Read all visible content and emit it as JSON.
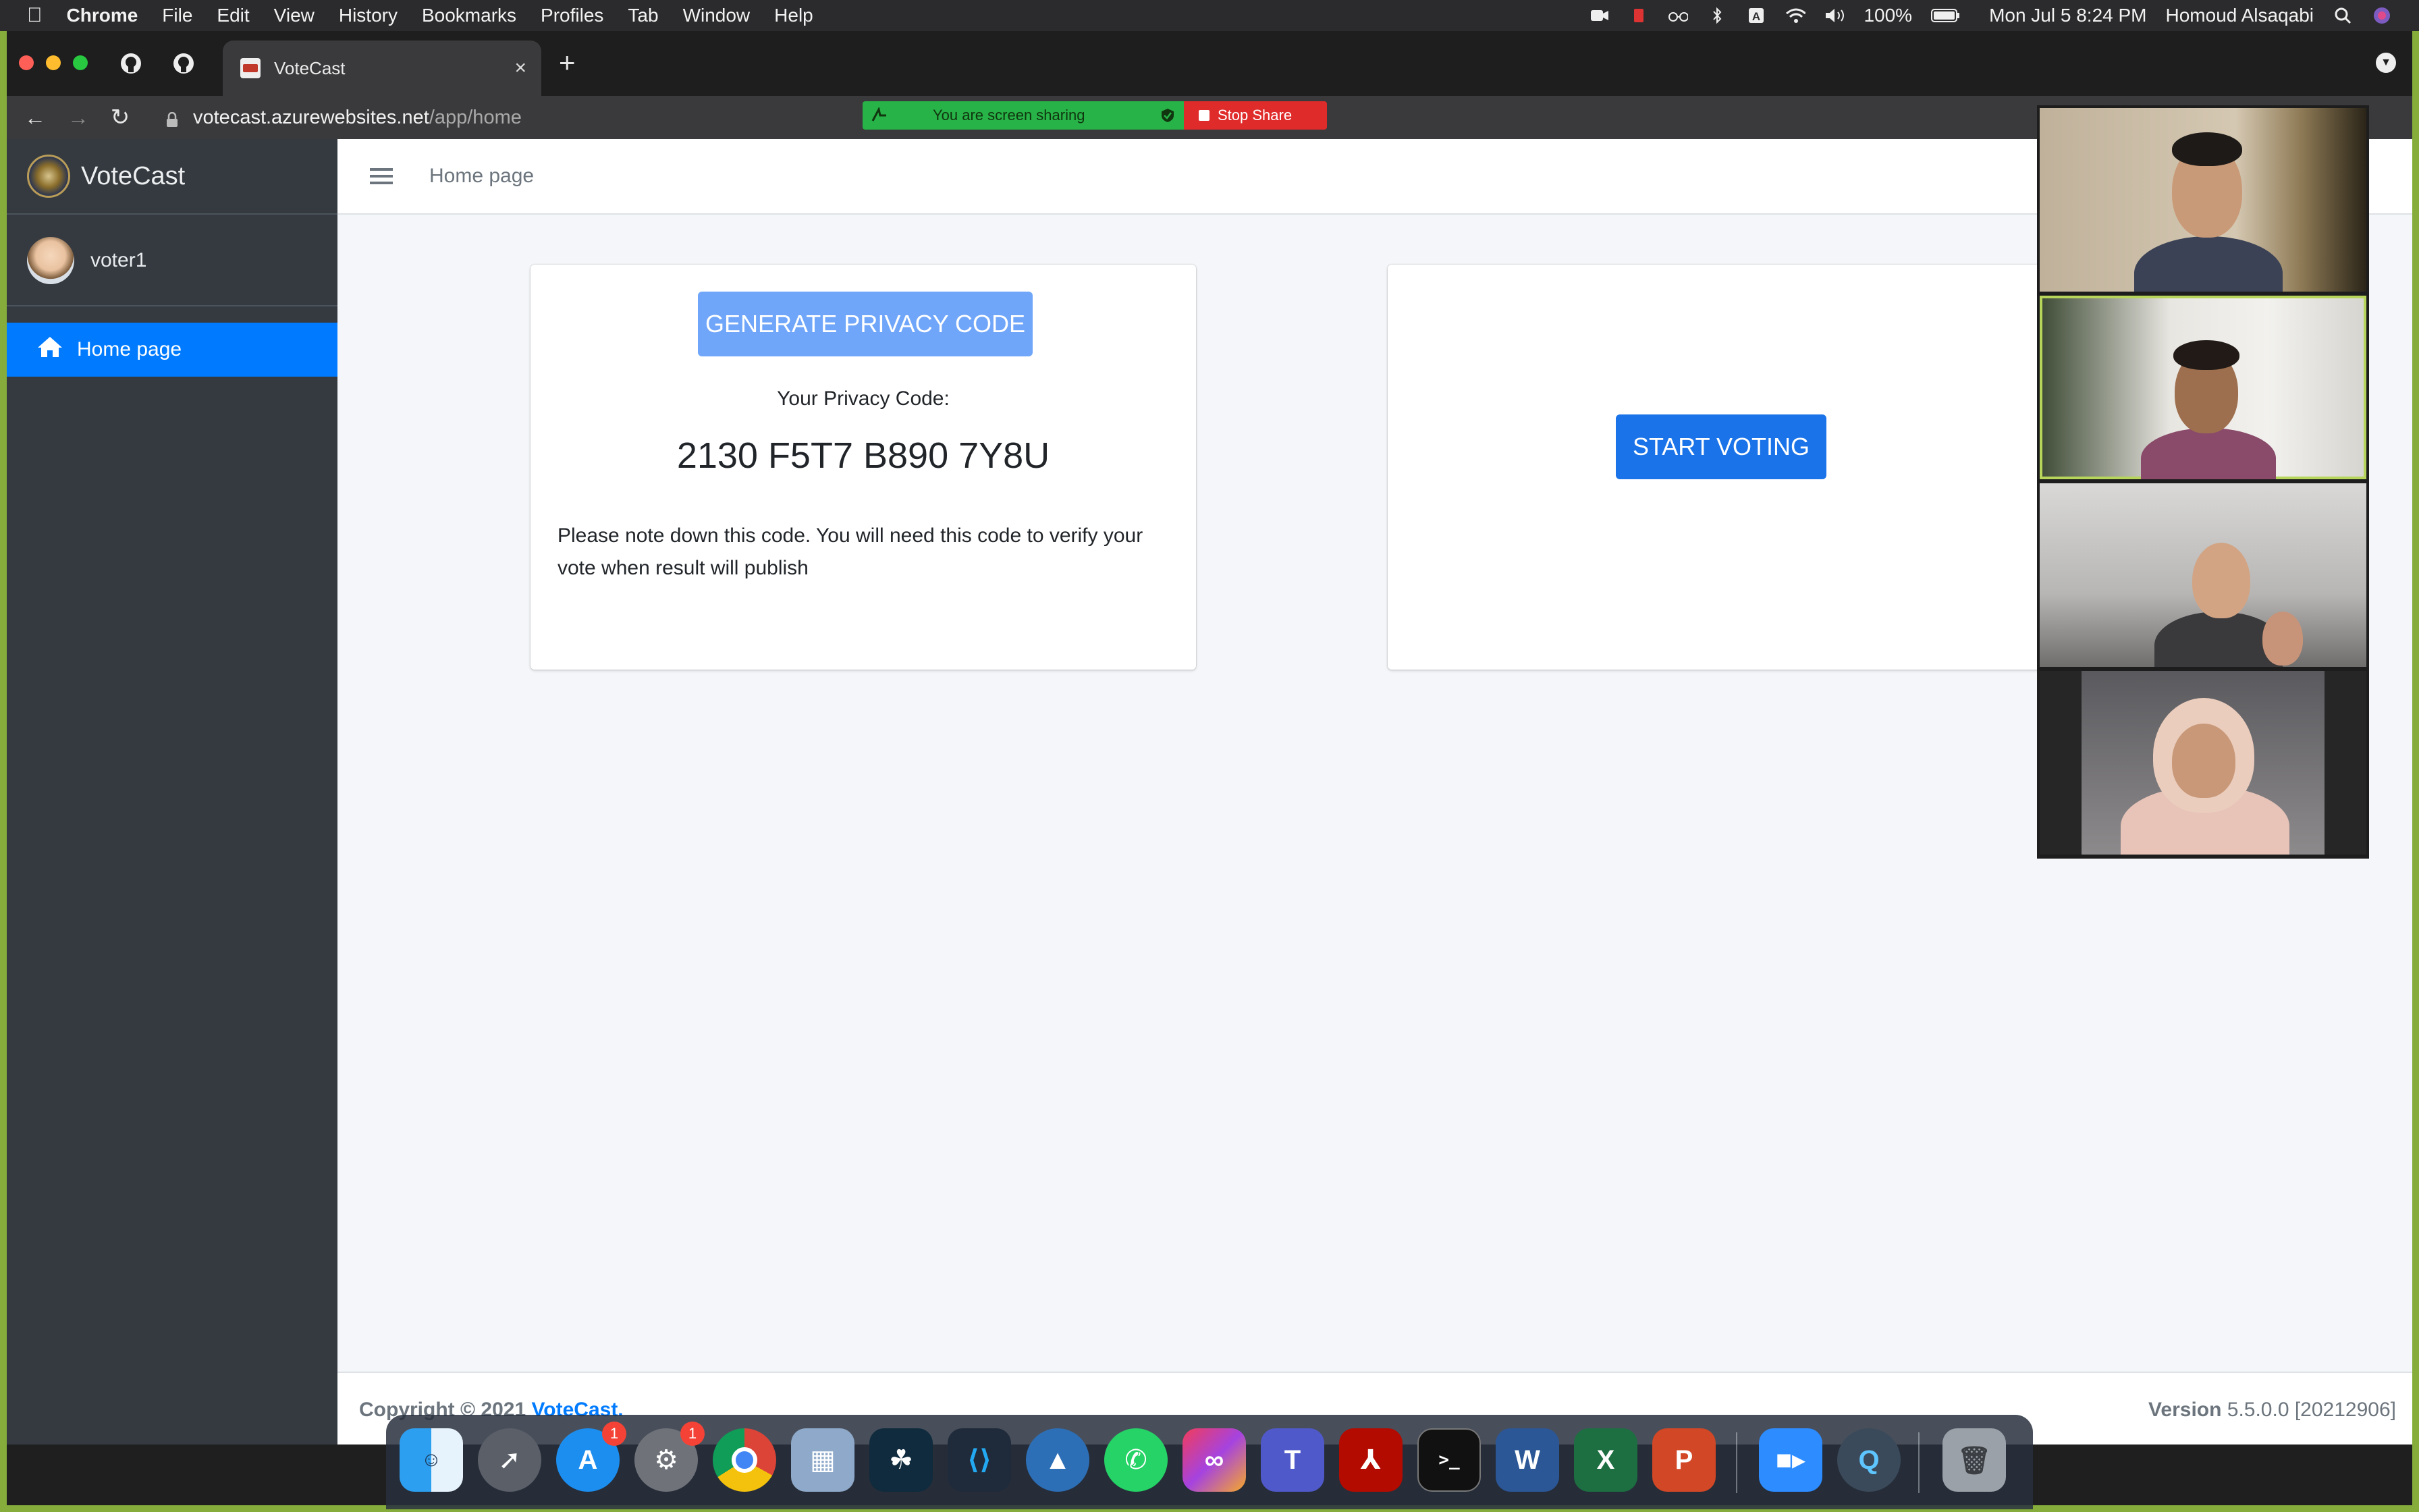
{
  "menubar": {
    "app_name": "Chrome",
    "menus": [
      "File",
      "Edit",
      "View",
      "History",
      "Bookmarks",
      "Profiles",
      "Tab",
      "Window",
      "Help"
    ],
    "battery": "100%",
    "clock": "Mon Jul 5  8:24 PM",
    "user": "Homoud Alsaqabi"
  },
  "browser": {
    "active_tab_title": "VoteCast",
    "url_host": "votecast.azurewebsites.net",
    "url_path": "/app/home"
  },
  "share_banner": {
    "message": "You are screen sharing",
    "stop_label": "Stop Share",
    "colors": {
      "sharing": "#27b347",
      "stop": "#e02b2b"
    }
  },
  "sidebar": {
    "brand": "VoteCast",
    "user_name": "voter1",
    "items": [
      {
        "label": "Home page",
        "icon": "home-icon",
        "active": true
      }
    ]
  },
  "header": {
    "breadcrumb": "Home page"
  },
  "privacy_card": {
    "button_label": "GENERATE PRIVACY CODE",
    "code_label": "Your Privacy Code:",
    "code_value": "2130 F5T7 B890 7Y8U",
    "note": "Please note down this code. You will need this code to verify your vote when result will publish"
  },
  "vote_card": {
    "button_label": "START VOTING"
  },
  "footer": {
    "copyright_prefix": "Copyright © 2021 ",
    "copyright_brand": "VoteCast.",
    "version_label": "Version",
    "version_value": " 5.5.0.0 [20212906]"
  },
  "dock": {
    "apps": [
      "Finder",
      "Launchpad",
      "App Store",
      "System Preferences",
      "Chrome",
      "Preview",
      "Kindle",
      "Visual Studio Code",
      "Mounty",
      "WhatsApp",
      "Creative Cloud",
      "Teams",
      "Acrobat",
      "Terminal",
      "Word",
      "Excel",
      "PowerPoint",
      "Zoom",
      "QuickTime",
      "Trash"
    ],
    "badges": {
      "App Store": "1",
      "System Preferences": "1"
    }
  },
  "colors": {
    "primary": "#007bff",
    "sidebar_bg": "#343a40",
    "disabled_button": "#70a6f9"
  }
}
